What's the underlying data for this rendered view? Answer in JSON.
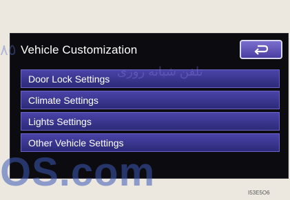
{
  "screen": {
    "title": "Vehicle Customization",
    "back_icon": "return-arrow-icon",
    "menu_items": [
      {
        "label": "Door Lock Settings"
      },
      {
        "label": "Climate Settings"
      },
      {
        "label": "Lights Settings"
      },
      {
        "label": "Other Vehicle Settings"
      }
    ]
  },
  "watermark": {
    "text_fa": "تلفن شبانه روزی",
    "text_big": "OS.com",
    "text_top": "٨٥"
  },
  "image_code": "I53E5O6"
}
